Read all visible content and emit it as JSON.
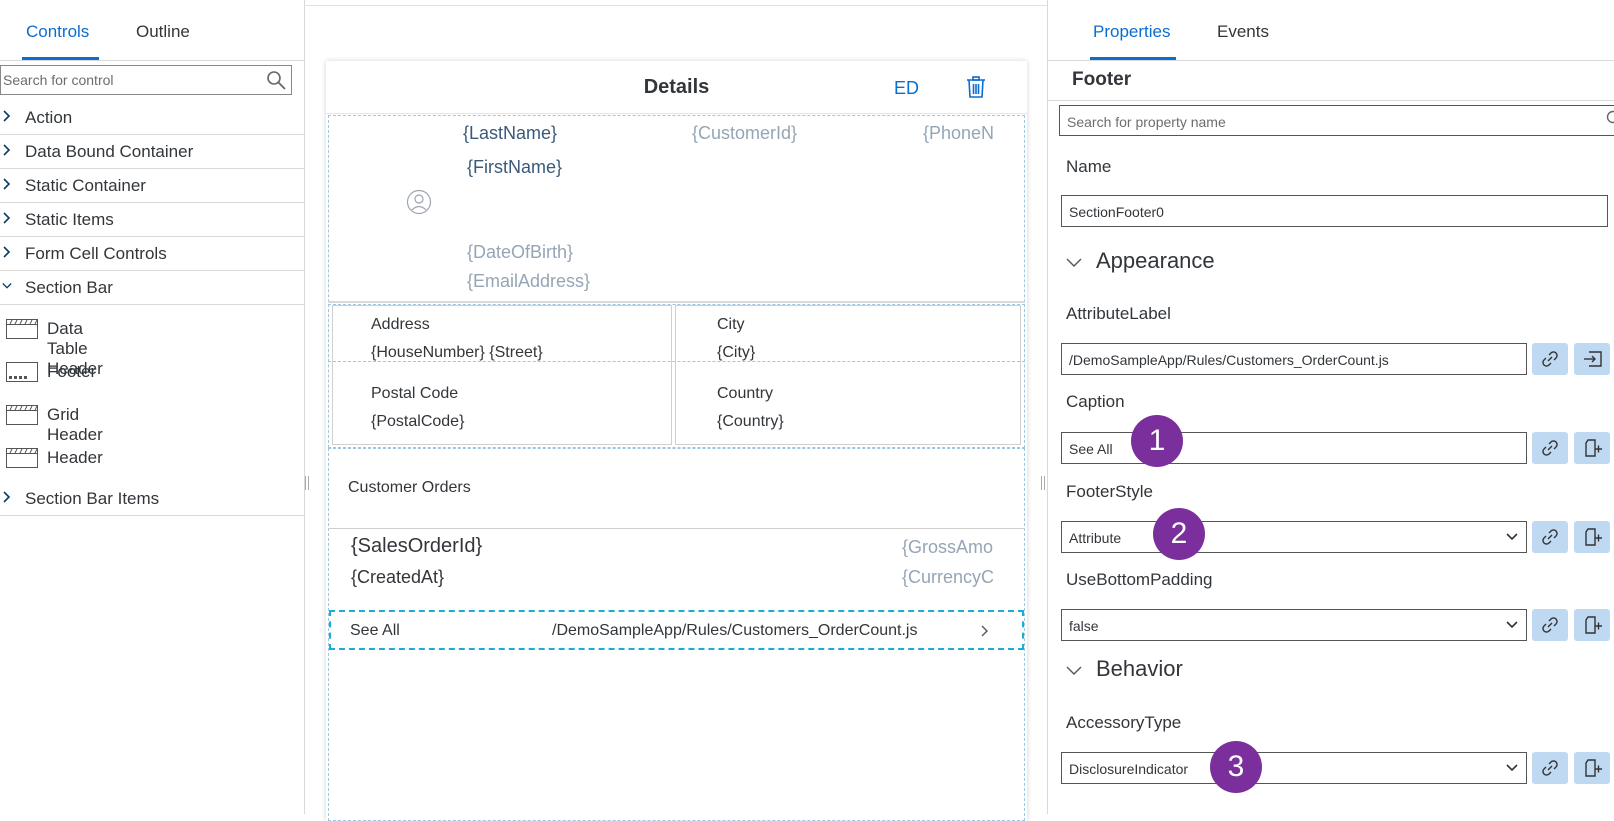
{
  "left_panel": {
    "tabs": [
      {
        "label": "Controls"
      },
      {
        "label": "Outline"
      }
    ],
    "search_placeholder": "Search for control",
    "categories": [
      {
        "label": "Action"
      },
      {
        "label": "Data Bound Container"
      },
      {
        "label": "Static Container"
      },
      {
        "label": "Static Items"
      },
      {
        "label": "Form Cell Controls"
      },
      {
        "label": "Section Bar"
      }
    ],
    "section_bar_items": [
      {
        "label": "Data Table Header"
      },
      {
        "label": "Footer"
      },
      {
        "label": "Grid Header"
      },
      {
        "label": "Header"
      }
    ],
    "last_category": {
      "label": "Section Bar Items"
    }
  },
  "canvas": {
    "title": "Details",
    "ed_label": "ED",
    "header": {
      "last_name": "{LastName}",
      "customer_id": "{CustomerId}",
      "phone": "{PhoneN",
      "first_name": "{FirstName}",
      "dob": "{DateOfBirth}",
      "email": "{EmailAddress}"
    },
    "address": {
      "address_label": "Address",
      "address_value": "{HouseNumber} {Street}",
      "postal_label": "Postal Code",
      "postal_value": "{PostalCode}",
      "city_label": "City",
      "city_value": "{City}",
      "country_label": "Country",
      "country_value": "{Country}"
    },
    "orders_header": "Customer Orders",
    "order_item": {
      "sales_order_id": "{SalesOrderId}",
      "created_at": "{CreatedAt}",
      "gross_amount": "{GrossAmo",
      "currency": "{CurrencyC"
    },
    "footer": {
      "caption": "See All",
      "attribute": "/DemoSampleApp/Rules/Customers_OrderCount.js"
    }
  },
  "right_panel": {
    "tabs": [
      {
        "label": "Properties"
      },
      {
        "label": "Events"
      }
    ],
    "heading": "Footer",
    "search_placeholder": "Search for property name",
    "name_label": "Name",
    "name_value": "SectionFooter0",
    "appearance_label": "Appearance",
    "attribute_label_label": "AttributeLabel",
    "attribute_label_value": "/DemoSampleApp/Rules/Customers_OrderCount.js",
    "caption_label": "Caption",
    "caption_value": "See All",
    "footer_style_label": "FooterStyle",
    "footer_style_value": "Attribute",
    "use_bottom_padding_label": "UseBottomPadding",
    "use_bottom_padding_value": "false",
    "behavior_label": "Behavior",
    "accessory_type_label": "AccessoryType",
    "accessory_type_value": "DisclosureIndicator"
  },
  "badges": [
    "1",
    "2",
    "3"
  ],
  "colors": {
    "accent": "#0a6ed1",
    "badge": "#7b2f9d",
    "button_bg": "#bfd9f2",
    "footer_highlight": "#1aaed6"
  }
}
